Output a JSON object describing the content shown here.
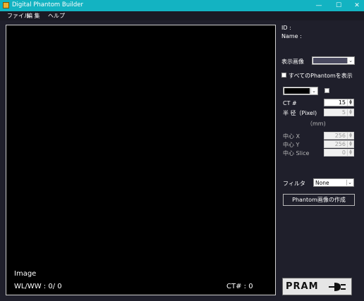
{
  "window": {
    "title": "Digital Phantom Builder",
    "minimize_glyph": "—",
    "maximize_glyph": "☐",
    "close_glyph": "✕"
  },
  "menu": {
    "file": "ファイル",
    "edit": "編 集",
    "help": "ヘルプ"
  },
  "viewer": {
    "image_label": "Image",
    "wlww": "WL/WW :  0/ 0",
    "ct": "CT# : 0"
  },
  "panel": {
    "id_label": "ID :",
    "name_label": "Name :",
    "display_label": "表示画像",
    "display_value": "",
    "show_all_label": "すべてのPhantomを表示",
    "show_all_checked": false,
    "color_value": "",
    "ct_label": "CT #",
    "ct_value": "15",
    "radius_label": "半  径（Pixel)",
    "radius_value": "5",
    "mm_label": "（mm)",
    "cx_label": "中心 X",
    "cx_value": "256",
    "cy_label": "中心 Y",
    "cy_value": "256",
    "cslice_label": "中心 Slice",
    "cslice_value": "0",
    "filter_label": "フィルタ",
    "filter_value": "None",
    "create_button": "Phantom画像の作成"
  },
  "logo": {
    "text": "PRAM",
    "icon": "plug-icon"
  },
  "colors": {
    "titlebar": "#13b3c2",
    "background": "#1f1f2b",
    "viewer": "#000000"
  }
}
